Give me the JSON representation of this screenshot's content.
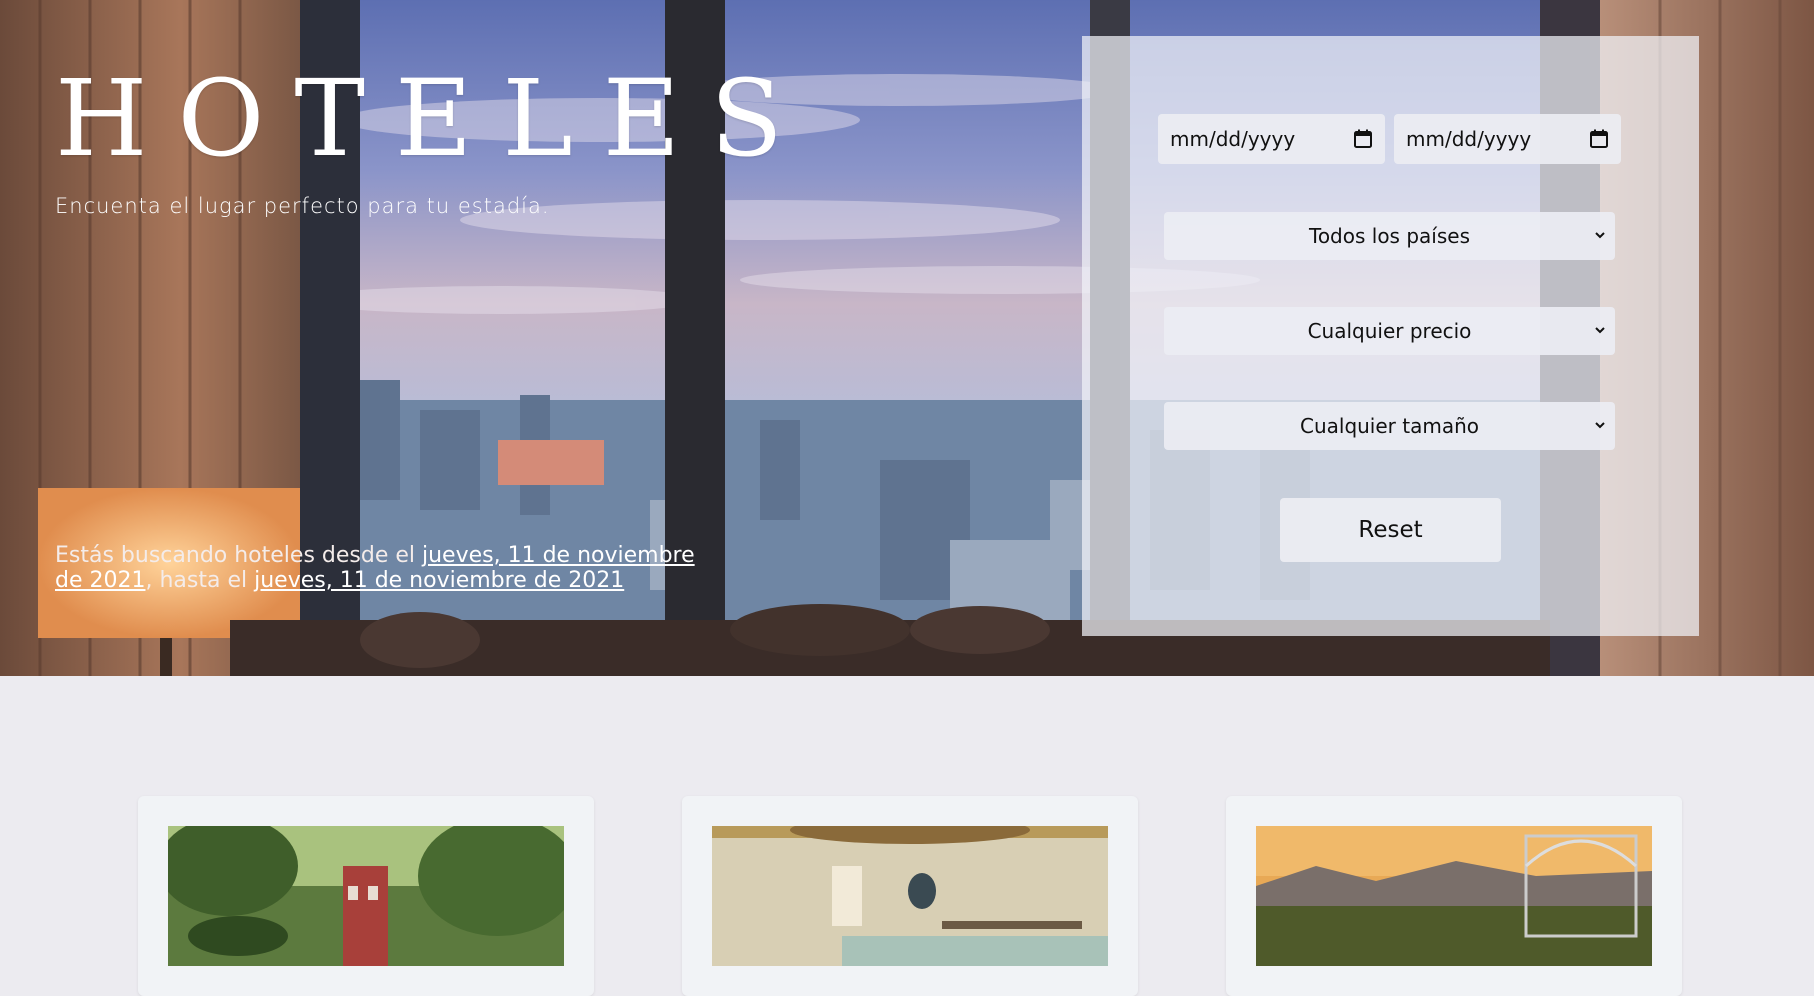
{
  "hero": {
    "title": "HOTELES",
    "subtitle": "Encuenta el lugar perfecto para tu estadía.",
    "summary": {
      "prefix": "Estás buscando hoteles desde el ",
      "from_date": "jueves, 11 de noviembre de 2021",
      "middle": ", hasta el ",
      "to_date": "jueves, 11 de noviembre de 2021"
    }
  },
  "filters": {
    "date_from_placeholder": "mm/dd/yyyy",
    "date_to_placeholder": "mm/dd/yyyy",
    "country_selected": "Todos los países",
    "price_selected": "Cualquier precio",
    "size_selected": "Cualquier tamaño",
    "reset_label": "Reset"
  },
  "icons": {
    "date_from": "calendar-icon",
    "date_to": "calendar-icon",
    "select": "chevron-down-icon"
  },
  "colors": {
    "page_background": "#ecebf0",
    "panel_background": "#f1f3f8",
    "card_background": "#f1f3f6"
  }
}
